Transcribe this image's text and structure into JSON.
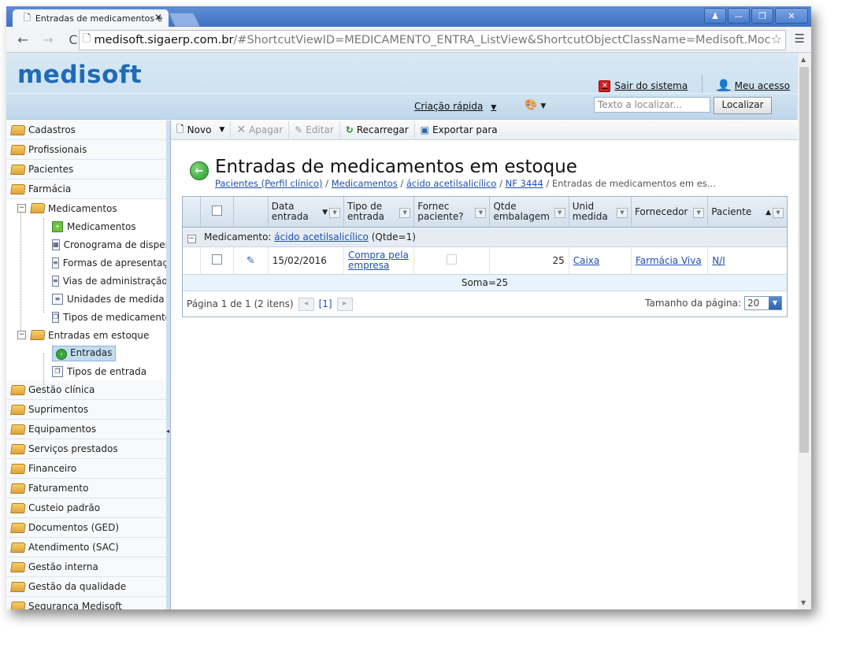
{
  "browser": {
    "tab_title": "Entradas de medicamentos e",
    "url_host": "medisoft.sigaerp.com.br",
    "url_path": "/#ShortcutViewID=MEDICAMENTO_ENTRA_ListView&ShortcutObjectClassName=Medisoft.Moc"
  },
  "header": {
    "logo": "medisoft",
    "logout_label": "Sair do sistema",
    "myaccess_label": "Meu acesso",
    "quick_create_label": "Criação rápida",
    "search_placeholder": "Texto a localizar...",
    "find_label": "Localizar"
  },
  "sidebar": {
    "groups_top": [
      "Cadastros",
      "Profissionais",
      "Pacientes",
      "Farmácia"
    ],
    "medicamentos_label": "Medicamentos",
    "medicamentos_children": [
      "Medicamentos",
      "Cronograma de dispens",
      "Formas de apresentaçã",
      "Vias de administração",
      "Unidades de medida",
      "Tipos de medicamento"
    ],
    "entradas_label": "Entradas em estoque",
    "entradas_children": [
      "Entradas",
      "Tipos de entrada"
    ],
    "groups_bottom": [
      "Gestão clínica",
      "Suprimentos",
      "Equipamentos",
      "Serviços prestados",
      "Financeiro",
      "Faturamento",
      "Custeio padrão",
      "Documentos (GED)",
      "Atendimento (SAC)",
      "Gestão interna",
      "Gestão da qualidade",
      "Segurança Medisoft"
    ]
  },
  "toolbar": {
    "new_label": "Novo",
    "delete_label": "Apagar",
    "edit_label": "Editar",
    "reload_label": "Recarregar",
    "export_label": "Exportar para"
  },
  "page": {
    "title": "Entradas de medicamentos em estoque",
    "breadcrumb": [
      "Pacientes (Perfil clínico)",
      "Medicamentos",
      "ácido acetilsalicílico",
      "NF 3444"
    ],
    "breadcrumb_current": "Entradas de medicamentos em es..."
  },
  "grid": {
    "columns": {
      "date_l1": "Data",
      "date_l2": "entrada",
      "type_l1": "Tipo de",
      "type_l2": "entrada",
      "supplier_q_l1": "Fornec",
      "supplier_q_l2": "paciente?",
      "qty_l1": "Qtde",
      "qty_l2": "embalagem",
      "unit_l1": "Unid",
      "unit_l2": "medida",
      "supplier": "Fornecedor",
      "patient": "Paciente"
    },
    "group_prefix": "Medicamento:",
    "group_link": "ácido acetilsalicílico",
    "group_count": "(Qtde=1)",
    "row": {
      "date": "15/02/2016",
      "type_l1": "Compra pela",
      "type_l2": "empresa",
      "qty": "25",
      "unit": "Caixa",
      "supplier": "Farmácia Viva",
      "patient": "N/I"
    },
    "sum": "Soma=25",
    "pager_text": "Página 1 de 1 (2 itens)",
    "pager_current": "[1]",
    "page_size_label": "Tamanho da página:",
    "page_size": "20"
  }
}
